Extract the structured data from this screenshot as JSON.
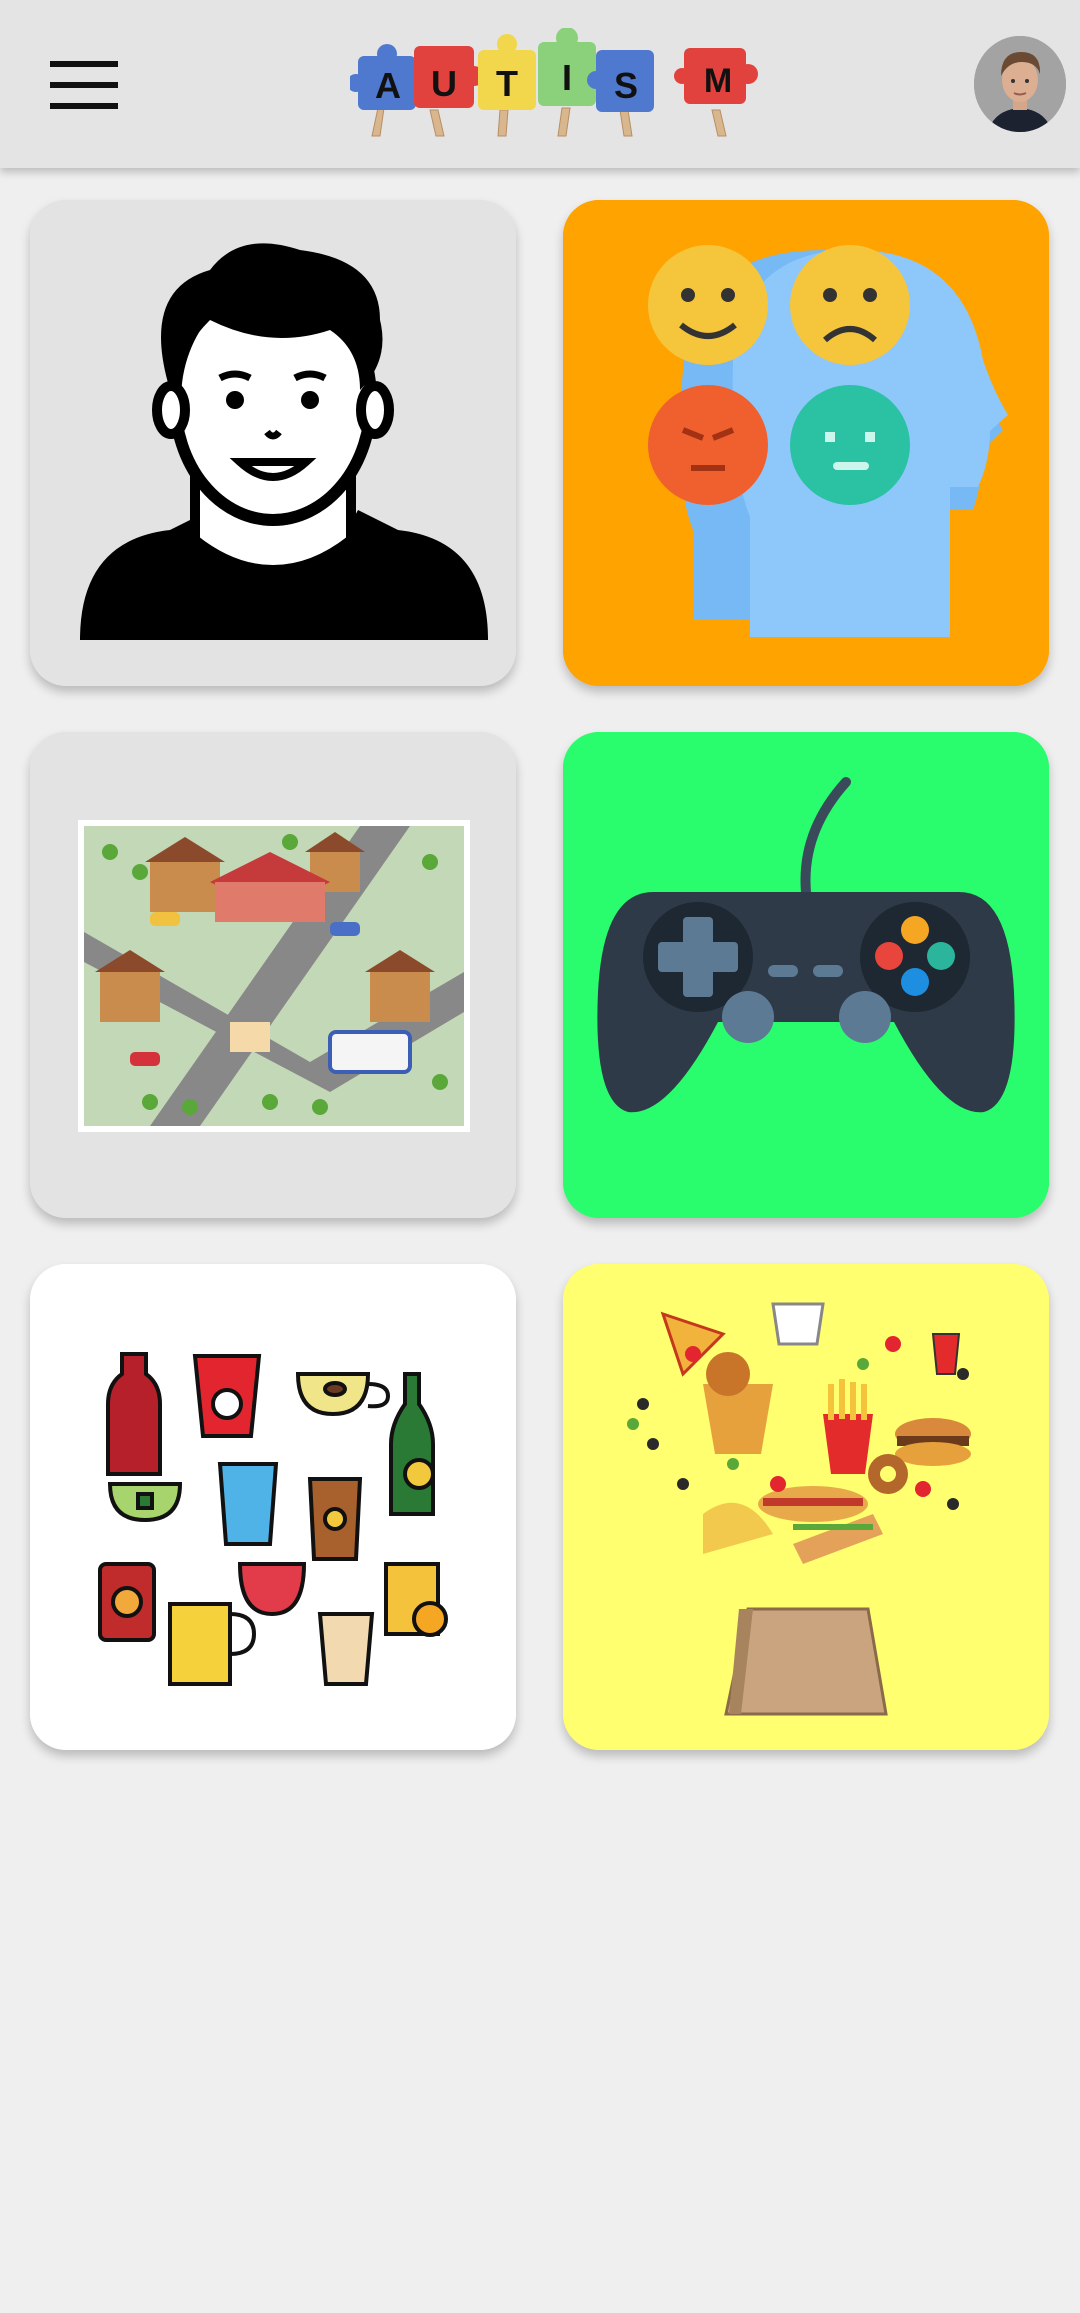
{
  "header": {
    "logo_letters": [
      "A",
      "U",
      "T",
      "I",
      "S",
      "M"
    ],
    "logo_piece_colors": [
      "#4f79cf",
      "#e2423d",
      "#f2d64b",
      "#8bd17c",
      "#4f79cf",
      "#e2423d"
    ],
    "menu_icon": "hamburger-menu-icon",
    "avatar_icon": "user-profile-photo"
  },
  "tiles": [
    {
      "id": "person",
      "icon": "person-portrait-icon",
      "background": "#e3e3e3"
    },
    {
      "id": "emotions",
      "icon": "emotions-faces-head-icon",
      "background": "#ffa300"
    },
    {
      "id": "city",
      "icon": "city-town-illustration-icon",
      "background": "#e3e3e3"
    },
    {
      "id": "games",
      "icon": "game-controller-icon",
      "background": "#29fd6d"
    },
    {
      "id": "drinks",
      "icon": "drinks-beverages-icon",
      "background": "#ffffff"
    },
    {
      "id": "food",
      "icon": "food-fast-food-bag-icon",
      "background": "#ffff70"
    }
  ]
}
